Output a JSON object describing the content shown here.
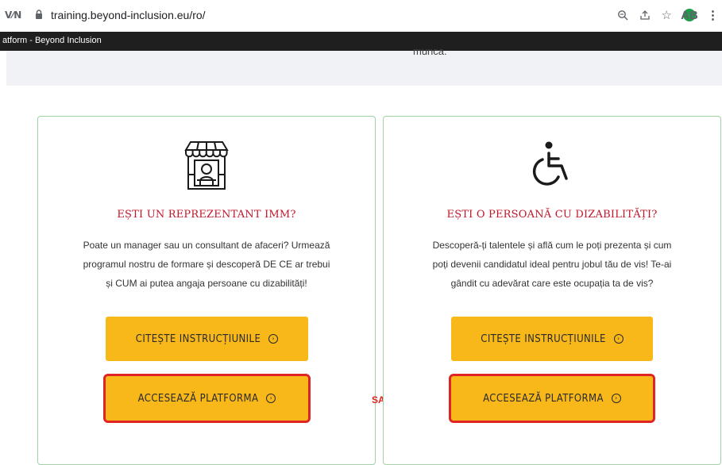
{
  "browser": {
    "vpn_label": "V⁄N",
    "url": "training.beyond-inclusion.eu/ro/",
    "extension_badge": "AB",
    "page_title": "atform - Beyond Inclusion"
  },
  "page": {
    "cut_text": "munca."
  },
  "cards": [
    {
      "icon": "shop-vendor-icon",
      "heading": "EȘTI UN REPREZENTANT IMM?",
      "lines": [
        "Poate un manager sau un consultant de afaceri? Urmează",
        "programul nostru de formare și descoperă DE CE ar trebui",
        "și CUM ai putea angaja persoane cu dizabilități!"
      ],
      "read_label": "CITEȘTE INSTRUCȚIUNILE",
      "access_label": "ACCESEAZĂ PLATFORMA"
    },
    {
      "icon": "wheelchair-icon",
      "heading": "EȘTI O PERSOANĂ CU DIZABILITĂȚI?",
      "lines": [
        "Descoperă-ți talentele și află cum le poți prezenta și cum",
        "poți devenii candidatul ideal pentru jobul tău de vis! Te-ai",
        "gândit cu adevărat care este ocupația ta de vis?"
      ],
      "read_label": "CITEȘTE INSTRUCȚIUNILE",
      "access_label": "ACCESEAZĂ PLATFORMA"
    }
  ],
  "separator": "SAU",
  "colors": {
    "accent": "#f9b81a",
    "heading": "#c0152a",
    "highlight": "#e02424",
    "card_border": "#9ed3a3"
  }
}
